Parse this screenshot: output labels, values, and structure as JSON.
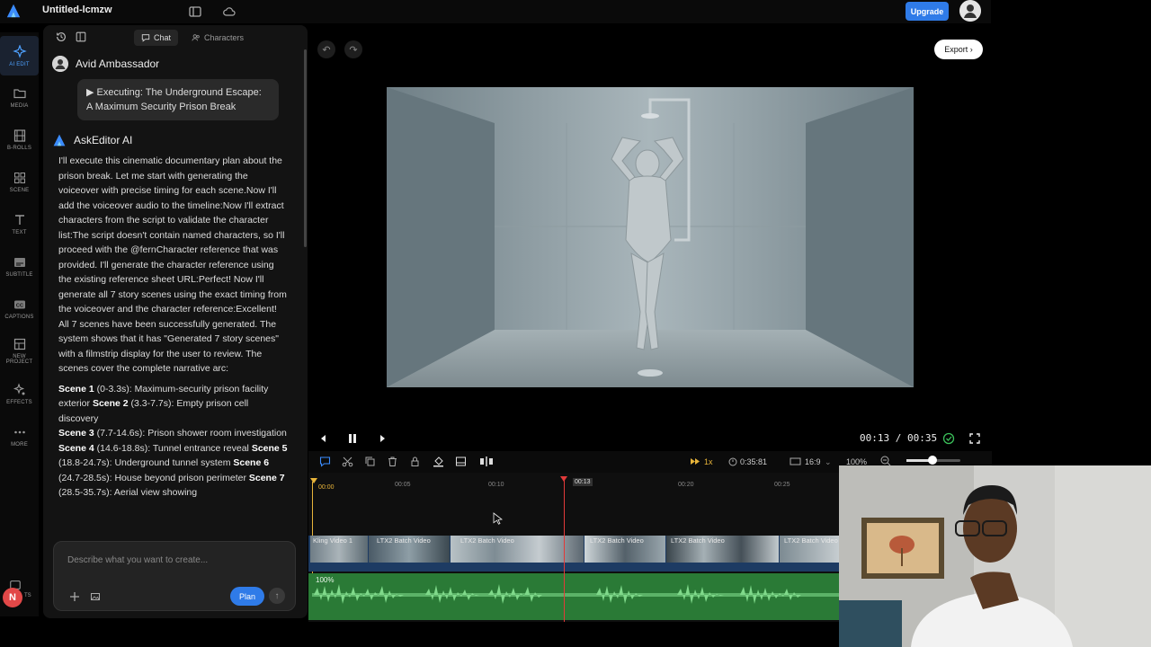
{
  "app": {
    "title": "Untitled-lcmzw",
    "upgrade_label": "Upgrade"
  },
  "rail": {
    "items": [
      {
        "label": "AI EDIT",
        "icon": "sparkle-icon",
        "active": true
      },
      {
        "label": "MEDIA",
        "icon": "folder-icon"
      },
      {
        "label": "B-ROLLS",
        "icon": "film-icon"
      },
      {
        "label": "SCENE",
        "icon": "grid-icon"
      },
      {
        "label": "TEXT",
        "icon": "text-icon"
      },
      {
        "label": "SUBTITLE",
        "icon": "subtitle-icon"
      },
      {
        "label": "CAPTIONS",
        "icon": "cc-icon"
      },
      {
        "label": "NEW",
        "label2": "PROJECT",
        "icon": "layout-icon"
      },
      {
        "label": "EFFECTS",
        "icon": "effects-icon"
      },
      {
        "label": "MORE",
        "icon": "more-icon"
      }
    ],
    "user_initial": "N",
    "partial_label": "TS"
  },
  "chat": {
    "tabs": [
      {
        "label": "Chat",
        "active": true
      },
      {
        "label": "Characters",
        "active": false
      }
    ],
    "user_name": "Avid Ambassador",
    "executing_text": "▶ Executing: The Underground Escape: A Maximum Security Prison Break",
    "ai_name": "AskEditor AI",
    "ai_paragraph": "I'll execute this cinematic documentary plan about the prison break. Let me start with generating the voiceover with precise timing for each scene.Now I'll add the voiceover audio to the timeline:Now I'll extract characters from the script to validate the character list:The script doesn't contain named characters, so I'll proceed with the @fernCharacter reference that was provided. I'll generate the character reference using the existing reference sheet URL:Perfect! Now I'll generate all 7 story scenes using the exact timing from the voiceover and the character reference:Excellent! All 7 scenes have been successfully generated. The system shows that it has \"Generated 7 story scenes\" with a filmstrip display for the user to review. The scenes cover the complete narrative arc:",
    "scenes": [
      {
        "name": "Scene 1",
        "desc": " (0-3.3s): Maximum-security prison facility exterior "
      },
      {
        "name": "Scene 2",
        "desc": " (3.3-7.7s): Empty prison cell discovery"
      },
      {
        "name": "Scene 3",
        "desc": " (7.7-14.6s): Prison shower room investigation "
      },
      {
        "name": "Scene 4",
        "desc": " (14.6-18.8s): Tunnel entrance reveal "
      },
      {
        "name": "Scene 5",
        "desc": " (18.8-24.7s): Underground tunnel system "
      },
      {
        "name": "Scene 6",
        "desc": " (24.7-28.5s): House beyond prison perimeter "
      },
      {
        "name": "Scene 7",
        "desc": " (28.5-35.7s): Aerial view showing"
      }
    ],
    "input_placeholder": "Describe what you want to create...",
    "plan_label": "Plan"
  },
  "player": {
    "export_label": "Export",
    "timecode": "00:13 / 00:35"
  },
  "toolbar": {
    "speed": "1x",
    "duration": "0:35:81",
    "aspect": "16:9",
    "zoom": "100%"
  },
  "timeline": {
    "ruler": [
      "00:00",
      "00:05",
      "00:10",
      "00:13",
      "00:20",
      "00:25"
    ],
    "clips": [
      "Kling Video 1",
      "LTX2 Batch Video",
      "LTX2 Batch Video",
      "LTX2 Batch Video",
      "LTX2 Batch Video",
      "LTX2 Batch Video"
    ],
    "audio_volume": "100%"
  }
}
